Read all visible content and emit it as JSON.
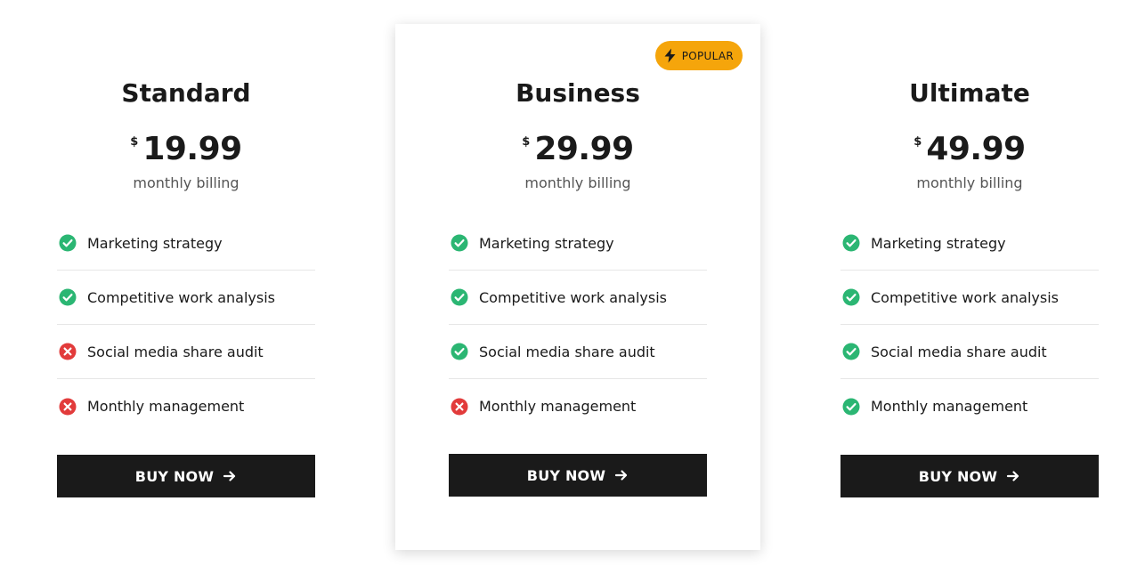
{
  "plans": [
    {
      "name": "Standard",
      "currency": "$",
      "price": "19.99",
      "billing": "monthly billing",
      "features": [
        {
          "label": "Marketing strategy",
          "included": true
        },
        {
          "label": "Competitive work analysis",
          "included": true
        },
        {
          "label": "Social media share audit",
          "included": false
        },
        {
          "label": "Monthly management",
          "included": false
        }
      ],
      "button_label": "BUY NOW",
      "button_icon": "arrow-right-icon"
    },
    {
      "name": "Business",
      "currency": "$",
      "price": "29.99",
      "billing": "monthly billing",
      "badge": {
        "label": "POPULAR",
        "icon": "lightning-bolt-icon",
        "color": "#f5a50b"
      },
      "features": [
        {
          "label": "Marketing strategy",
          "included": true
        },
        {
          "label": "Competitive work analysis",
          "included": true
        },
        {
          "label": "Social media share audit",
          "included": true
        },
        {
          "label": "Monthly management",
          "included": false
        }
      ],
      "button_label": "BUY NOW",
      "button_icon": "arrow-right-icon"
    },
    {
      "name": "Ultimate",
      "currency": "$",
      "price": "49.99",
      "billing": "monthly billing",
      "features": [
        {
          "label": "Marketing strategy",
          "included": true
        },
        {
          "label": "Competitive work analysis",
          "included": true
        },
        {
          "label": "Social media share audit",
          "included": true
        },
        {
          "label": "Monthly management",
          "included": true
        }
      ],
      "button_label": "BUY NOW",
      "button_icon": "arrow-right-icon"
    }
  ],
  "colors": {
    "included": "#2bb673",
    "excluded": "#e23b3b",
    "button_bg": "#1a1a1a",
    "badge_bg": "#f5a50b"
  },
  "icons": {
    "included": "check-circle-icon",
    "excluded": "x-circle-icon"
  }
}
